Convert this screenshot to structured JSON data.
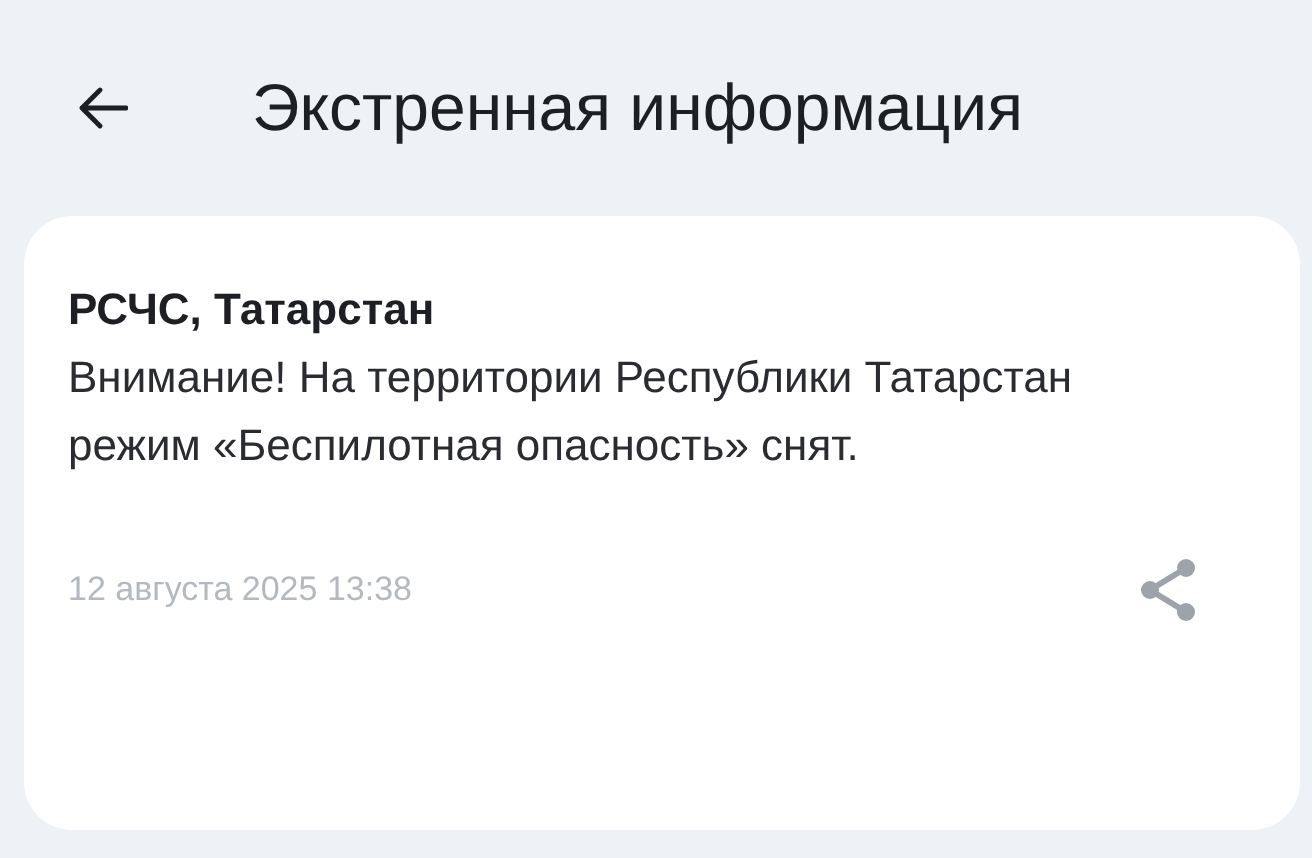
{
  "header": {
    "title": "Экстренная информация"
  },
  "message": {
    "sender": "РСЧС, Татарстан",
    "text": "Внимание! На территории Республики Татарстан режим «Беспилотная опасность» снят.",
    "date": "12 августа 2025 13:38"
  }
}
